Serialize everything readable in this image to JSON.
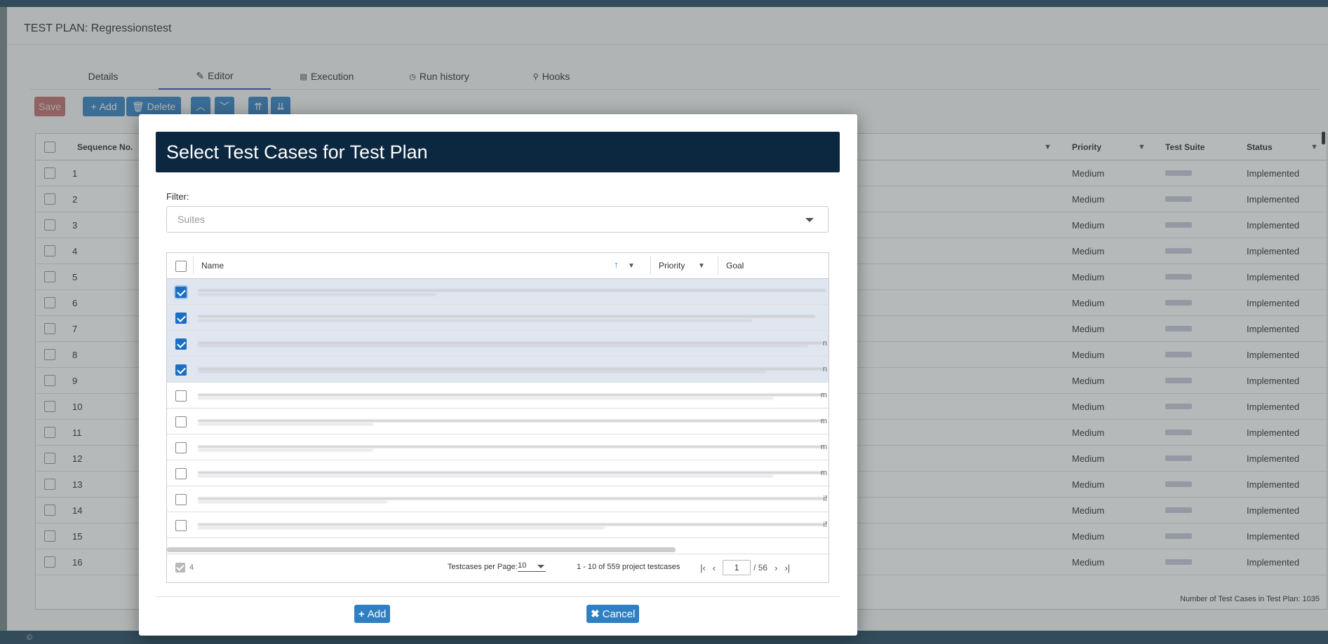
{
  "page": {
    "title": "TEST PLAN: Regressionstest",
    "footer_left": "©",
    "footer_right": ""
  },
  "tabs": [
    {
      "label": "Details",
      "icon": ""
    },
    {
      "label": "Editor",
      "icon": "pencil-icon"
    },
    {
      "label": "Execution",
      "icon": "log-icon"
    },
    {
      "label": "Run history",
      "icon": "history-icon"
    },
    {
      "label": "Hooks",
      "icon": "hook-icon"
    }
  ],
  "toolbar": {
    "save_label": "Save",
    "add_label": "Add",
    "delete_label": "Delete"
  },
  "plan_grid": {
    "columns": {
      "sequence": "Sequence No.",
      "priority": "Priority",
      "test_suite": "Test Suite",
      "status": "Status"
    },
    "rows": [
      {
        "seq": "1",
        "priority": "Medium",
        "status": "Implemented"
      },
      {
        "seq": "2",
        "priority": "Medium",
        "status": "Implemented"
      },
      {
        "seq": "3",
        "priority": "Medium",
        "status": "Implemented"
      },
      {
        "seq": "4",
        "priority": "Medium",
        "status": "Implemented"
      },
      {
        "seq": "5",
        "priority": "Medium",
        "status": "Implemented"
      },
      {
        "seq": "6",
        "priority": "Medium",
        "status": "Implemented"
      },
      {
        "seq": "7",
        "priority": "Medium",
        "status": "Implemented"
      },
      {
        "seq": "8",
        "priority": "Medium",
        "status": "Implemented"
      },
      {
        "seq": "9",
        "priority": "Medium",
        "status": "Implemented"
      },
      {
        "seq": "10",
        "priority": "Medium",
        "status": "Implemented"
      },
      {
        "seq": "11",
        "priority": "Medium",
        "status": "Implemented"
      },
      {
        "seq": "12",
        "priority": "Medium",
        "status": "Implemented"
      },
      {
        "seq": "13",
        "priority": "Medium",
        "status": "Implemented"
      },
      {
        "seq": "14",
        "priority": "Medium",
        "status": "Implemented"
      },
      {
        "seq": "15",
        "priority": "Medium",
        "status": "Implemented"
      },
      {
        "seq": "16",
        "priority": "Medium",
        "status": "Implemented"
      }
    ],
    "footer": "Number of Test Cases in Test Plan: 1035"
  },
  "modal": {
    "title": "Select Test Cases for Test Plan",
    "filter_label": "Filter:",
    "filter_placeholder": "Suites",
    "columns": {
      "name": "Name",
      "priority": "Priority",
      "goal": "Goal"
    },
    "rows": [
      {
        "checked": true,
        "end": ""
      },
      {
        "checked": true,
        "end": ""
      },
      {
        "checked": true,
        "end": "n"
      },
      {
        "checked": true,
        "end": "n"
      },
      {
        "checked": false,
        "end": "m"
      },
      {
        "checked": false,
        "end": "m"
      },
      {
        "checked": false,
        "end": "m"
      },
      {
        "checked": false,
        "end": "m"
      },
      {
        "checked": false,
        "end": "if"
      },
      {
        "checked": false,
        "end": "if"
      }
    ],
    "selected_count": "4",
    "per_page_label": "Testcases per Page:",
    "per_page_value": "10",
    "range_text": "1 - 10 of 559 project testcases",
    "current_page": "1",
    "total_pages": "/ 56",
    "add_label": "Add",
    "cancel_label": "Cancel"
  }
}
